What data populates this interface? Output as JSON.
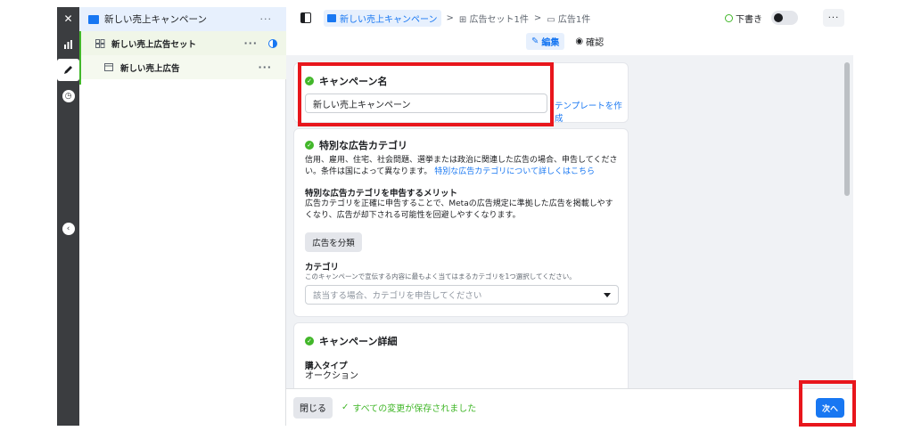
{
  "rail": {
    "items": [
      "close-icon",
      "chart-icon",
      "pencil-icon",
      "clock-icon"
    ],
    "collapse_icon": "chevron-left-icon"
  },
  "tree": {
    "campaign": "新しい売上キャンペーン",
    "adset": "新しい売上広告セット",
    "ad": "新しい売上広告",
    "more": "···"
  },
  "topbar": {
    "crumb_campaign": "新しい売上キャンペーン",
    "crumb_adset": "広告セット1件",
    "crumb_ad": "広告1件",
    "sep": ">",
    "draft": "下書き",
    "more": "···"
  },
  "modes": {
    "edit": "編集",
    "review": "確認"
  },
  "campaign_name": {
    "title": "キャンペーン名",
    "value": "新しい売上キャンペーン",
    "template_link": "テンプレートを作成"
  },
  "special_category": {
    "title": "特別な広告カテゴリ",
    "desc": "信用、雇用、住宅、社会問題、選挙または政治に関連した広告の場合、申告してください。条件は国によって異なります。",
    "learn_link": "特別な広告カテゴリについて詳しくはこちら",
    "benefit_title": "特別な広告カテゴリを申告するメリット",
    "benefit_desc": "広告カテゴリを正確に申告することで、Metaの広告規定に準拠した広告を掲載しやすくなり、広告が却下される可能性を回避しやすくなります。",
    "classify_button": "広告を分類",
    "category_label": "カテゴリ",
    "category_help": "このキャンペーンで宣伝する内容に最もよく当てはまるカテゴリを1つ選択してください。",
    "category_placeholder": "該当する場合、カテゴリを申告してください"
  },
  "campaign_details": {
    "title": "キャンペーン詳細",
    "purchase_type_label": "購入タイプ",
    "purchase_type_value": "オークション"
  },
  "footer": {
    "close": "閉じる",
    "saved": "すべての変更が保存されました",
    "next": "次へ"
  },
  "colors": {
    "accent": "#1877f2",
    "success": "#42b72a",
    "highlight": "#e8161c"
  }
}
